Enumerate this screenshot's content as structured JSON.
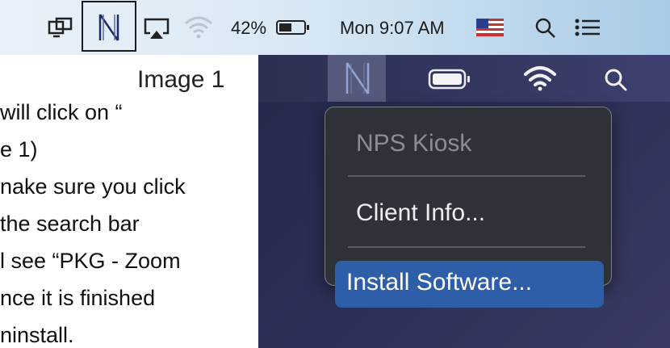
{
  "menubar": {
    "battery_percent": "42%",
    "clock": "Mon 9:07 AM"
  },
  "doc": {
    "title": "Image 1",
    "lines": [
      " will click on “",
      "e 1)",
      "nake sure you click",
      " the search bar",
      "l see “PKG - Zoom",
      "nce it is finished",
      "ninstall."
    ]
  },
  "dark_menu": {
    "nps_logo": "N",
    "items": [
      {
        "label": "NPS Kiosk",
        "enabled": false
      },
      {
        "label": "Client Info...",
        "enabled": true
      },
      {
        "label": "Install Software...",
        "enabled": true,
        "selected": true
      }
    ]
  },
  "colors": {
    "selected_item": "#2f5ea8",
    "menu_background": "#2f3139",
    "disabled_text": "#8b8d96"
  },
  "icons": [
    "screen-mirror-icon",
    "nps-kiosk-icon",
    "airplay-icon",
    "wifi-icon",
    "battery-icon",
    "us-flag-icon",
    "spotlight-search-icon",
    "control-center-list-icon"
  ]
}
